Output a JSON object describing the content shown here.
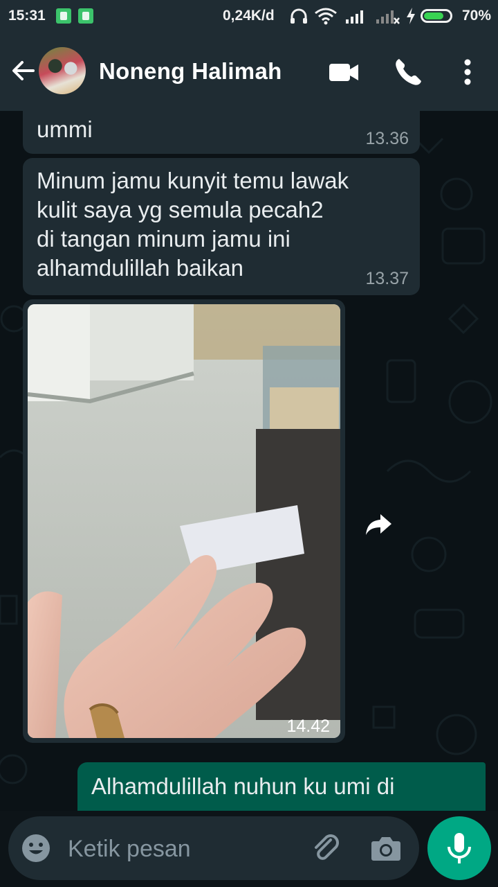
{
  "status_bar": {
    "time": "15:31",
    "net_speed": "0,24K/d",
    "battery_pct": "70%",
    "battery_level": 0.7
  },
  "header": {
    "contact_name": "Noneng Halimah",
    "icons": [
      "back-arrow-icon",
      "video-call-icon",
      "phone-icon",
      "more-vert-icon"
    ]
  },
  "messages": [
    {
      "type": "in",
      "text": "ummi",
      "time": "13.36"
    },
    {
      "type": "in",
      "lines": [
        "Minum jamu kunyit temu lawak",
        "kulit saya yg semula pecah2",
        "di tangan minum jamu ini",
        "alhamdulillah baikan"
      ],
      "time": "13.37"
    },
    {
      "type": "in-image",
      "time": "14.42"
    },
    {
      "type": "out",
      "text": "Alhamdulillah nuhun ku umi di"
    }
  ],
  "input": {
    "placeholder": "Ketik pesan"
  },
  "colors": {
    "header_bg": "#1f2c33",
    "incoming_bubble": "#1f2c33",
    "outgoing_bubble": "#005c4b",
    "accent": "#00a884"
  }
}
